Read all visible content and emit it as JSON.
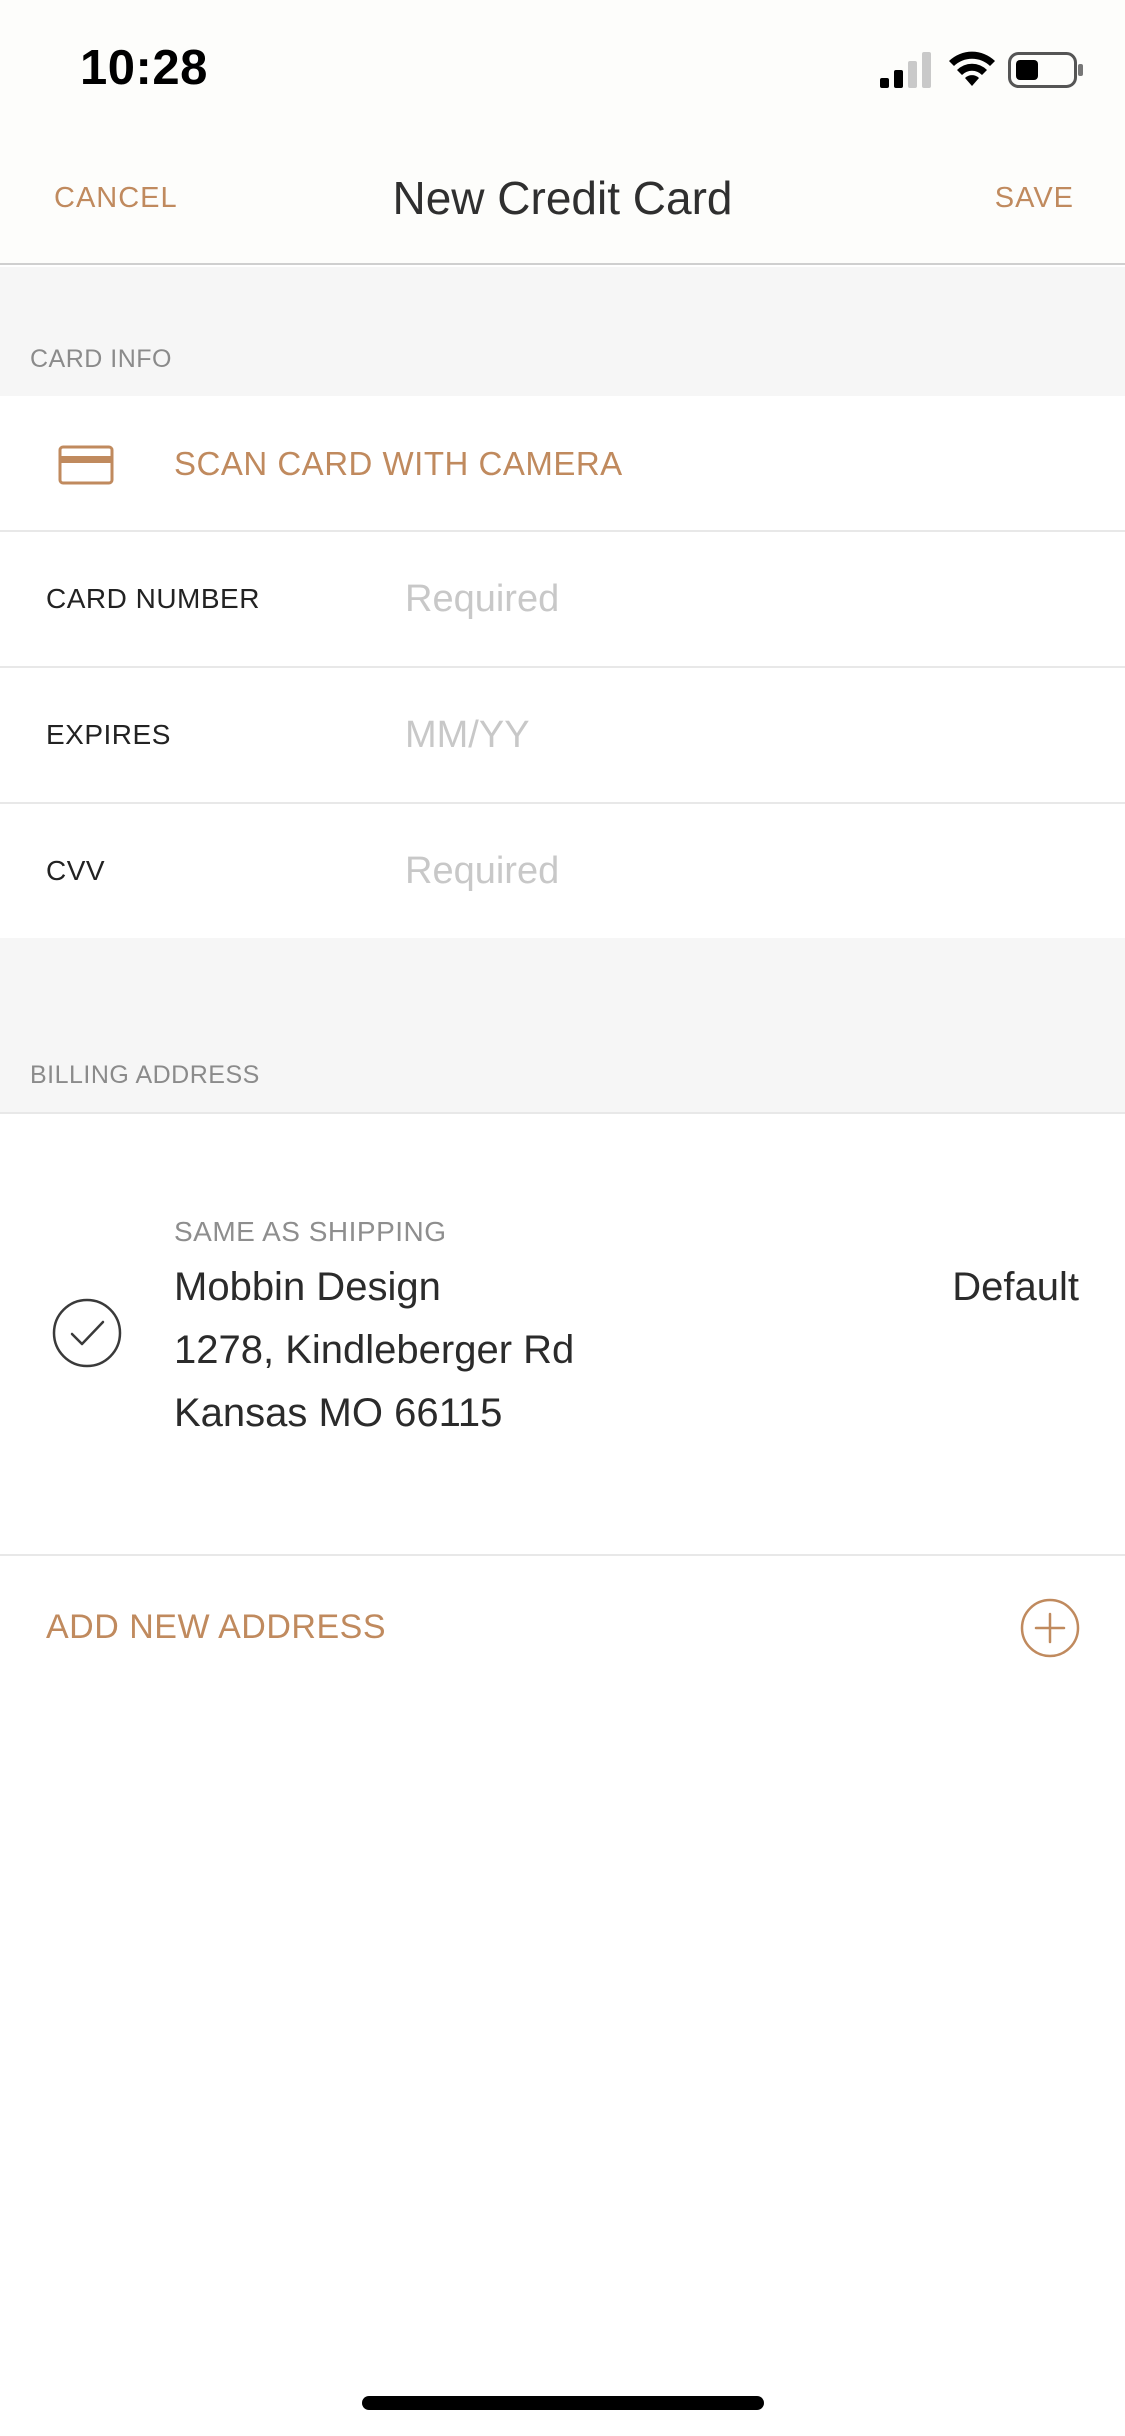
{
  "status_bar": {
    "time": "10:28",
    "icons": [
      "signal-icon",
      "wifi-icon",
      "battery-icon"
    ]
  },
  "nav": {
    "cancel_label": "CANCEL",
    "title": "New Credit Card",
    "save_label": "SAVE"
  },
  "card_info": {
    "section_label": "CARD INFO",
    "scan_label": "SCAN CARD WITH CAMERA",
    "scan_icon": "credit-card-icon",
    "fields": [
      {
        "label": "CARD NUMBER",
        "value": "",
        "placeholder": "Required"
      },
      {
        "label": "EXPIRES",
        "value": "",
        "placeholder": "MM/YY"
      },
      {
        "label": "CVV",
        "value": "",
        "placeholder": "Required"
      }
    ]
  },
  "billing": {
    "section_label": "BILLING ADDRESS",
    "address": {
      "tag": "SAME AS SHIPPING",
      "name": "Mobbin Design",
      "street": "1278, Kindleberger Rd",
      "city": "Kansas MO 66115",
      "badge": "Default",
      "selected": true
    },
    "add_label": "ADD NEW ADDRESS",
    "add_icon": "plus-circle-icon"
  },
  "colors": {
    "accent": "#c08a5e",
    "section_bg": "#f6f6f6",
    "placeholder": "#c8c8c8",
    "divider": "#e8e8e8"
  }
}
